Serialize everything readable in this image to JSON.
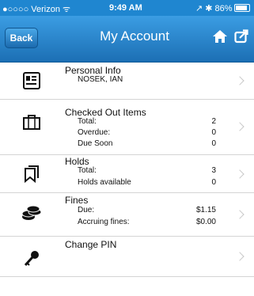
{
  "status_bar": {
    "carrier": "●○○○○ Verizon ᯤ",
    "time": "9:49 AM",
    "right": "↗ ✱ 86%",
    "battery_level": 0.86
  },
  "nav": {
    "back_label": "Back",
    "title": "My Account",
    "home_icon": "home-icon",
    "share_icon": "share-icon"
  },
  "accent_color": "#1f86d0",
  "items": {
    "personal": {
      "title": "Personal Info",
      "name": "NOSEK, IAN",
      "icon": "id-card-icon"
    },
    "checkedout": {
      "title": "Checked Out Items",
      "icon": "briefcase-icon",
      "rows": [
        {
          "label": "Total:",
          "value": "2"
        },
        {
          "label": "Overdue:",
          "value": "0"
        },
        {
          "label": "Due Soon",
          "value": "0"
        }
      ]
    },
    "holds": {
      "title": "Holds",
      "icon": "bookmark-icon",
      "rows": [
        {
          "label": "Total:",
          "value": "3"
        },
        {
          "label": "Holds available",
          "value": "0"
        }
      ]
    },
    "fines": {
      "title": "Fines",
      "icon": "coins-icon",
      "rows": [
        {
          "label": "Due:",
          "value": "$1.15"
        },
        {
          "label": "Accruing fines:",
          "value": "$0.00"
        }
      ]
    },
    "pin": {
      "title": "Change PIN",
      "icon": "key-icon"
    }
  }
}
